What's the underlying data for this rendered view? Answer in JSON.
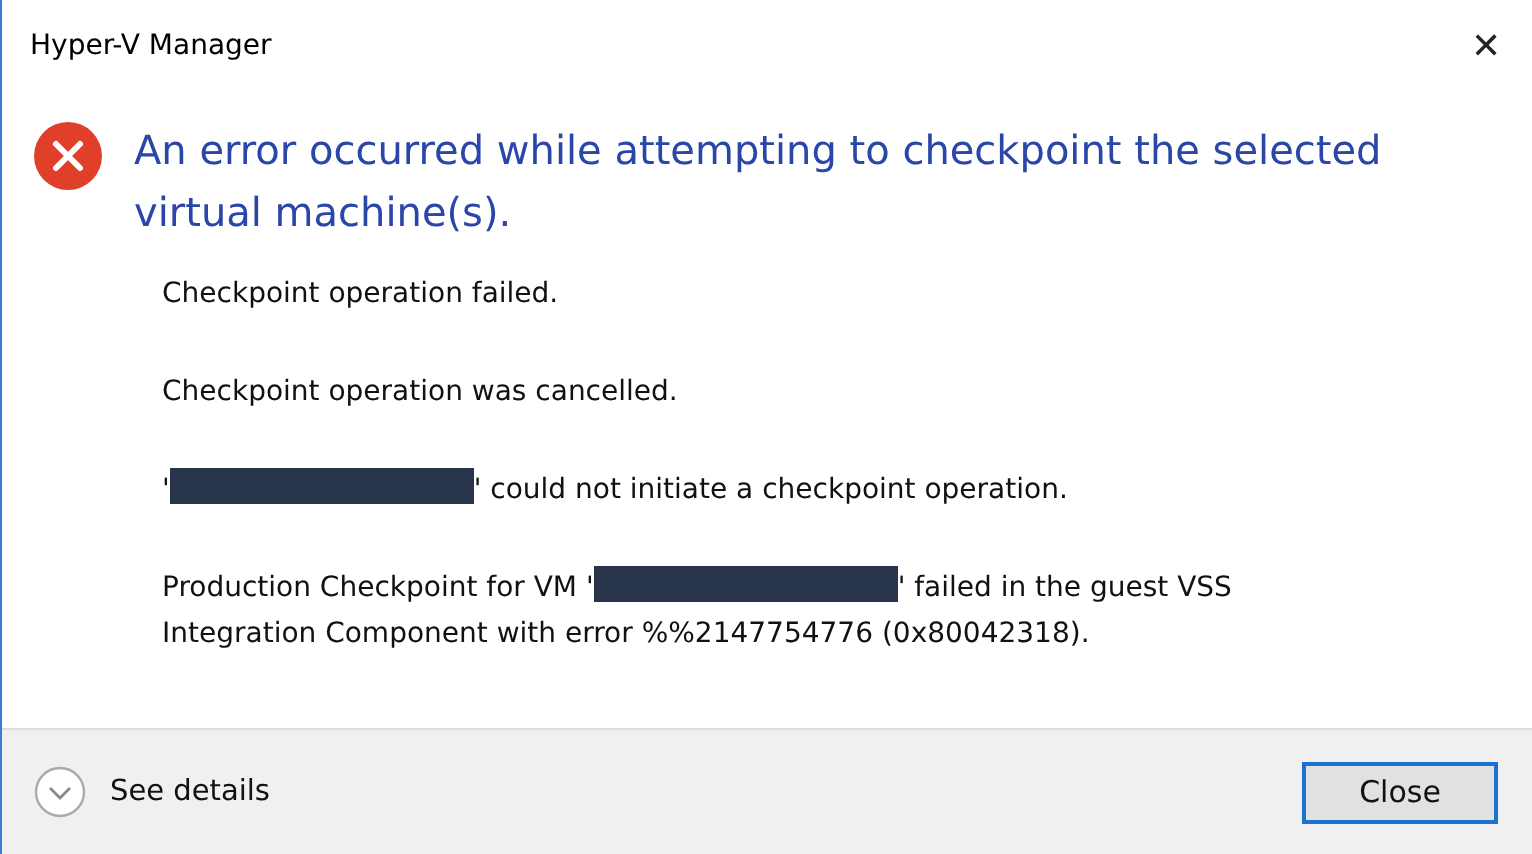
{
  "window": {
    "title": "Hyper-V Manager",
    "close_glyph": "✕"
  },
  "heading": "An error occurred while attempting to checkpoint the selected virtual machine(s).",
  "messages": [
    {
      "parts": [
        {
          "kind": "text",
          "text": "Checkpoint operation failed."
        }
      ]
    },
    {
      "parts": [
        {
          "kind": "text",
          "text": "Checkpoint operation was cancelled."
        }
      ]
    },
    {
      "parts": [
        {
          "kind": "text",
          "text": "'"
        },
        {
          "kind": "redacted"
        },
        {
          "kind": "text",
          "text": "' could not initiate a checkpoint operation."
        }
      ]
    },
    {
      "parts": [
        {
          "kind": "text",
          "text": "Production Checkpoint for VM '"
        },
        {
          "kind": "redacted"
        },
        {
          "kind": "text",
          "text": "' failed in the guest VSS"
        },
        {
          "kind": "text",
          "text": "Integration Component with error %%2147754776 (0x80042318)."
        }
      ]
    }
  ],
  "footer": {
    "details_label": "See details",
    "expanded": false,
    "button": "Close"
  }
}
